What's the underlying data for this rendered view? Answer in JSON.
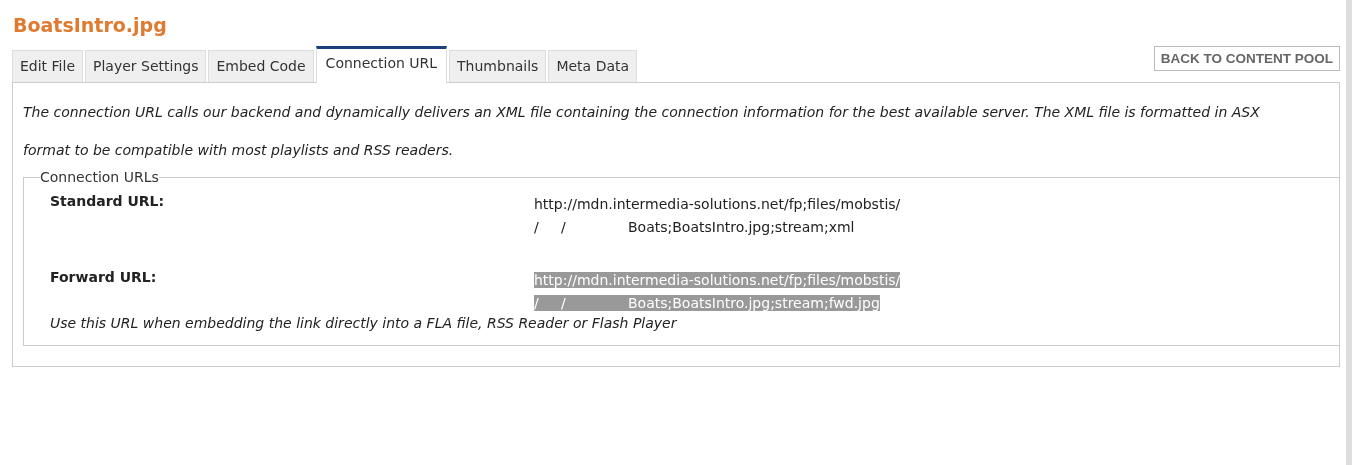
{
  "title": "BoatsIntro.jpg",
  "tabs": [
    {
      "label": "Edit File",
      "selected": false
    },
    {
      "label": "Player Settings",
      "selected": false
    },
    {
      "label": "Embed Code",
      "selected": false
    },
    {
      "label": "Connection URL",
      "selected": true
    },
    {
      "label": "Thumbnails",
      "selected": false
    },
    {
      "label": "Meta Data",
      "selected": false
    }
  ],
  "back_button": "BACK TO CONTENT POOL",
  "description": "The connection URL calls our backend and dynamically delivers an XML file containing the connection information for the best available server. The XML file is formatted in ASX format to be compatible with most playlists and RSS readers.",
  "fieldset": {
    "legend": "Connection URLs",
    "urls": [
      {
        "label": "Standard URL:",
        "lines": [
          "http://mdn.intermedia-solutions.net/fp;files/mobstis/",
          "/     /              Boats;BoatsIntro.jpg;stream;xml"
        ],
        "selected": false
      },
      {
        "label": "Forward URL:",
        "lines": [
          "http://mdn.intermedia-solutions.net/fp;files/mobstis/",
          "/     /              Boats;BoatsIntro.jpg;stream;fwd.jpg"
        ],
        "selected": true,
        "note": "Use this URL when embedding the link directly into a FLA file, RSS Reader or Flash Player"
      }
    ]
  }
}
